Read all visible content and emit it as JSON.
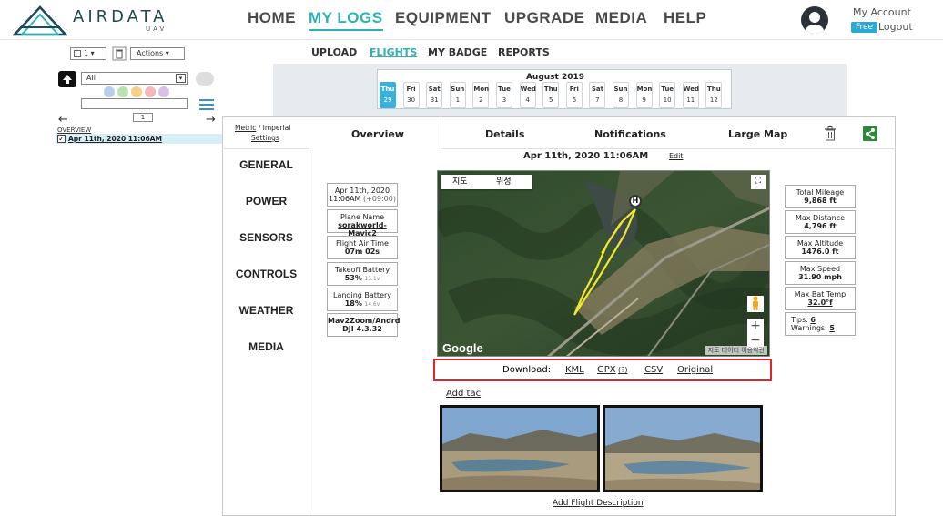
{
  "header": {
    "logo_text": "AIRDATA",
    "logo_sub": "UAV",
    "nav": [
      "HOME",
      "MY LOGS",
      "EQUIPMENT",
      "UPGRADE",
      "MEDIA",
      "HELP"
    ],
    "account": "My Account",
    "free_badge": "Free",
    "logout": "Logout"
  },
  "subnav": [
    "UPLOAD",
    "FLIGHTS",
    "MY BADGE",
    "REPORTS"
  ],
  "left": {
    "page_select": "1",
    "actions": "Actions",
    "filter_value": "All",
    "page_num": "1",
    "overview": "OVERVIEW",
    "flight_item": "Apr 11th, 2020 11:06AM",
    "dot_colors": [
      "#b7cfea",
      "#b9e4b0",
      "#f4d08a",
      "#f5b8b8",
      "#d9c2e6"
    ]
  },
  "calendar": {
    "month": "August 2019",
    "days": [
      {
        "d": "Thu",
        "n": "29"
      },
      {
        "d": "Fri",
        "n": "30"
      },
      {
        "d": "Sat",
        "n": "31"
      },
      {
        "d": "Sun",
        "n": "1"
      },
      {
        "d": "Mon",
        "n": "2"
      },
      {
        "d": "Tue",
        "n": "3"
      },
      {
        "d": "Wed",
        "n": "4"
      },
      {
        "d": "Thu",
        "n": "5"
      },
      {
        "d": "Fri",
        "n": "6"
      },
      {
        "d": "Sat",
        "n": "7"
      },
      {
        "d": "Sun",
        "n": "8"
      },
      {
        "d": "Mon",
        "n": "9"
      },
      {
        "d": "Tue",
        "n": "10"
      },
      {
        "d": "Wed",
        "n": "11"
      },
      {
        "d": "Thu",
        "n": "12"
      }
    ]
  },
  "units": {
    "metric": "Metric",
    "slash": " / ",
    "imperial": "Imperial",
    "settings": "Settings"
  },
  "tabs": {
    "overview": "Overview",
    "details": "Details",
    "notifications": "Notifications",
    "large_map": "Large Map"
  },
  "menu": [
    "GENERAL",
    "POWER",
    "SENSORS",
    "CONTROLS",
    "WEATHER",
    "MEDIA"
  ],
  "flight": {
    "title": "Apr 11th, 2020 11:06AM",
    "edit": "Edit"
  },
  "left_boxes": [
    {
      "line1": "Apr 11th, 2020",
      "line2": "11:06AM",
      "extra": "(+09:00)"
    },
    {
      "line1": "Plane Name",
      "line2": "sorakworld-Mavic2"
    },
    {
      "line1": "Flight Air Time",
      "line2": "07m 02s"
    },
    {
      "line1": "Takeoff Battery",
      "line2": "53%",
      "extra": "15.1v"
    },
    {
      "line1": "Landing Battery",
      "line2": "18%",
      "extra": "14.6v"
    },
    {
      "line1": "Mav2Zoom/Andrd",
      "line2": "DJI 4.3.32"
    }
  ],
  "right_boxes": [
    {
      "line1": "Total Mileage",
      "line2": "9,868 ft"
    },
    {
      "line1": "Max Distance",
      "line2": "4,796 ft"
    },
    {
      "line1": "Max Altitude",
      "line2": "1476.0 ft"
    },
    {
      "line1": "Max Speed",
      "line2": "31.90 mph"
    },
    {
      "line1": "Max Bat Temp",
      "line2": "32.0°f"
    }
  ],
  "tips": {
    "tips_label": "Tips:",
    "tips_val": "6",
    "warn_label": "Warnings:",
    "warn_val": "5"
  },
  "map": {
    "tab_map": "지도",
    "tab_sat": "위성",
    "google": "Google",
    "attribution": "지도 데이터  이용약관",
    "zoom_in": "+",
    "zoom_out": "−",
    "home_marker": "H"
  },
  "download": {
    "label": "Download:",
    "kml": "KML",
    "gpx": "GPX",
    "gpx_q": "(?)",
    "csv": "CSV",
    "original": "Original"
  },
  "add_tag": "Add tac",
  "add_desc": "Add Flight Description"
}
